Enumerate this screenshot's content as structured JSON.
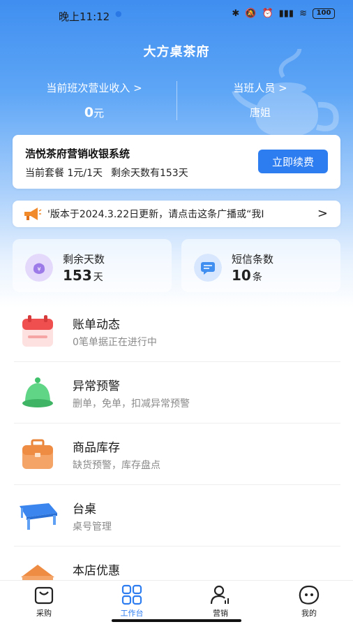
{
  "status_bar": {
    "time": "晚上11:12",
    "battery": "100"
  },
  "header": {
    "title": "大方桌茶府",
    "revenue_label": "当前班次营业收入 >",
    "revenue_value": "0",
    "revenue_unit": "元",
    "staff_label": "当班人员 >",
    "staff_value": "唐姐"
  },
  "package_card": {
    "title": "浩悦茶府营销收银系统",
    "plan": "当前套餐 1元/1天",
    "remaining": "剩余天数有153天",
    "renew_label": "立即续费"
  },
  "notice": {
    "text": "'版本于2024.3.22日更新，请点击这条广播或“我I",
    "chevron": ">"
  },
  "metrics": [
    {
      "label": "剩余天数",
      "value": "153",
      "unit": "天",
      "icon": "money-bag-icon"
    },
    {
      "label": "短信条数",
      "value": "10",
      "unit": "条",
      "icon": "message-icon"
    }
  ],
  "menu": [
    {
      "title": "账单动态",
      "subtitle": "0笔单据正在进行中",
      "icon": "calendar-icon"
    },
    {
      "title": "异常预警",
      "subtitle": "删单，免单，扣减异常预警",
      "icon": "bell-icon"
    },
    {
      "title": "商品库存",
      "subtitle": "缺货预警，库存盘点",
      "icon": "briefcase-icon"
    },
    {
      "title": "台桌",
      "subtitle": "桌号管理",
      "icon": "table-icon"
    },
    {
      "title": "本店优惠",
      "subtitle": "",
      "icon": "coupon-icon"
    }
  ],
  "tabs": [
    {
      "label": "采购",
      "icon": "shopping-bag-icon",
      "active": false
    },
    {
      "label": "工作台",
      "icon": "grid-icon",
      "active": true
    },
    {
      "label": "营销",
      "icon": "user-chart-icon",
      "active": false
    },
    {
      "label": "我的",
      "icon": "face-icon",
      "active": false
    }
  ],
  "colors": {
    "accent": "#2d7df0",
    "hero_top": "#3f8ef0",
    "muted_text": "#8a8a8a"
  }
}
